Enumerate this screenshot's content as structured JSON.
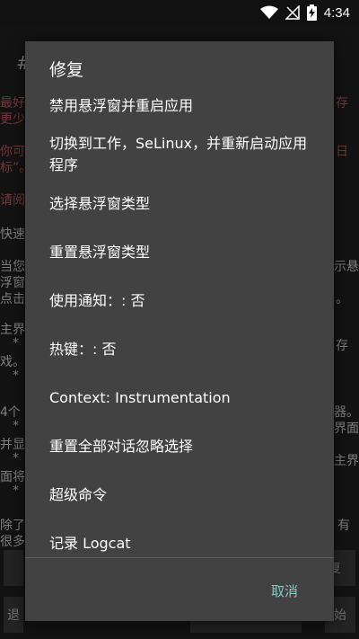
{
  "status_bar": {
    "time": "4:34",
    "icons": [
      "wifi-icon",
      "no-signal-icon",
      "battery-charging-icon"
    ]
  },
  "background": {
    "hash": "#",
    "fragments": [
      {
        "text": "最好",
        "color": "red"
      },
      {
        "text": "存",
        "color": "red"
      },
      {
        "text": "更少",
        "color": "red"
      },
      {
        "text": "你可",
        "color": "red"
      },
      {
        "text": "日",
        "color": "red"
      },
      {
        "text": "标”。",
        "color": "red"
      },
      {
        "text": "请阅",
        "color": "red"
      },
      {
        "text": "快速",
        "color": "white"
      },
      {
        "text": "当您",
        "color": "white"
      },
      {
        "text": "示悬",
        "color": "white"
      },
      {
        "text": "浮窗",
        "color": "white"
      },
      {
        "text": "点击",
        "color": "white"
      },
      {
        "text": "。",
        "color": "white"
      },
      {
        "text": "主界",
        "color": "white"
      },
      {
        "text": "*",
        "color": "white"
      },
      {
        "text": "存",
        "color": "white"
      },
      {
        "text": "戏。",
        "color": "white"
      },
      {
        "text": "*",
        "color": "white"
      },
      {
        "text": "4个",
        "color": "white"
      },
      {
        "text": "器。",
        "color": "white"
      },
      {
        "text": "*",
        "color": "white"
      },
      {
        "text": "界面",
        "color": "white"
      },
      {
        "text": "并显",
        "color": "white"
      },
      {
        "text": "*",
        "color": "white"
      },
      {
        "text": "主界",
        "color": "white"
      },
      {
        "text": "面将",
        "color": "white"
      },
      {
        "text": "*",
        "color": "white"
      },
      {
        "text": "除了",
        "color": "white"
      },
      {
        "text": "有",
        "color": "white"
      },
      {
        "text": "很多",
        "color": "white"
      }
    ],
    "buttons": [
      "复",
      "退",
      "始"
    ]
  },
  "dialog": {
    "title": "修复",
    "items": [
      {
        "label": "禁用悬浮窗并重启应用"
      },
      {
        "label": "切换到工作，SeLinux，并重新启动应用程序"
      },
      {
        "label": "选择悬浮窗类型"
      },
      {
        "label": "重置悬浮窗类型"
      },
      {
        "label": "使用通知：: 否"
      },
      {
        "label": "热键：: 否"
      },
      {
        "label": "Context: Instrumentation"
      },
      {
        "label": "重置全部对话忽略选择"
      },
      {
        "label": "超级命令"
      },
      {
        "label": "记录 Logcat"
      }
    ],
    "cancel_label": "取消",
    "accent_color": "#80cbc4"
  }
}
